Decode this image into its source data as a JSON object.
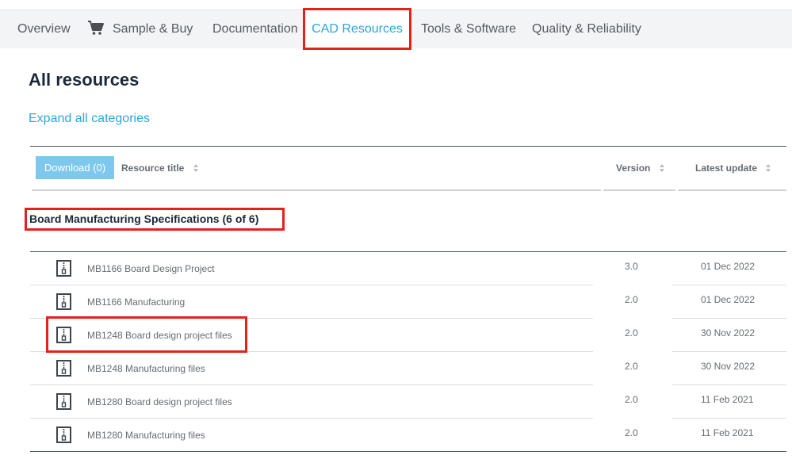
{
  "tabs": [
    {
      "label": "Overview",
      "icon": null
    },
    {
      "label": "Sample & Buy",
      "icon": "cart-icon"
    },
    {
      "label": "Documentation",
      "icon": null
    },
    {
      "label": "CAD Resources",
      "icon": null,
      "active": true
    },
    {
      "label": "Tools & Software",
      "icon": null
    },
    {
      "label": "Quality & Reliability",
      "icon": null
    }
  ],
  "page": {
    "title": "All resources",
    "expand_link": "Expand all categories"
  },
  "table_header": {
    "download_label": "Download (0)",
    "col_title": "Resource title",
    "col_version": "Version",
    "col_update": "Latest update"
  },
  "category": {
    "title": "Board Manufacturing Specifications (6 of 6)"
  },
  "rows": [
    {
      "title": "MB1166 Board Design Project",
      "version": "3.0",
      "date": "01 Dec 2022",
      "icon": "zip-file-icon"
    },
    {
      "title": "MB1166 Manufacturing",
      "version": "2.0",
      "date": "01 Dec 2022",
      "icon": "zip-file-icon"
    },
    {
      "title": "MB1248 Board design project files",
      "version": "2.0",
      "date": "30 Nov 2022",
      "icon": "zip-file-icon"
    },
    {
      "title": "MB1248 Manufacturing files",
      "version": "2.0",
      "date": "30 Nov 2022",
      "icon": "zip-file-icon"
    },
    {
      "title": "MB1280 Board design project files",
      "version": "2.0",
      "date": "11 Feb 2021",
      "icon": "zip-file-icon"
    },
    {
      "title": "MB1280 Manufacturing files",
      "version": "2.0",
      "date": "11 Feb 2021",
      "icon": "zip-file-icon"
    }
  ],
  "colors": {
    "accent": "#2aa7dd",
    "button": "#7dc8ec",
    "highlight": "#e2231a",
    "heading": "#1b2a3a"
  }
}
